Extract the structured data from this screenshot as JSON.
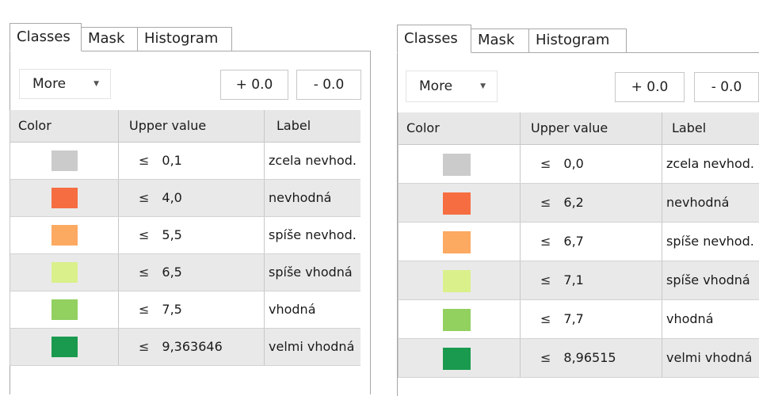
{
  "panels": [
    {
      "tabs": [
        "Classes",
        "Mask",
        "Histogram"
      ],
      "more_label": "More",
      "plus_label": "+ 0.0",
      "minus_label": "- 0.0",
      "columns": [
        "Color",
        "Upper value",
        "Label"
      ],
      "le_symbol": "≤",
      "rows": [
        {
          "color": "#cbcbcb",
          "value": "0,1",
          "label": "zcela nevhod."
        },
        {
          "color": "#f56d41",
          "value": "4,0",
          "label": "nevhodná"
        },
        {
          "color": "#fca962",
          "value": "5,5",
          "label": "spíše nevhod."
        },
        {
          "color": "#daf08b",
          "value": "6,5",
          "label": "spíše vhodná"
        },
        {
          "color": "#92d060",
          "value": "7,5",
          "label": "vhodná"
        },
        {
          "color": "#1a9a4e",
          "value": "9,363646",
          "label": "velmi vhodná"
        }
      ]
    },
    {
      "tabs": [
        "Classes",
        "Mask",
        "Histogram"
      ],
      "more_label": "More",
      "plus_label": "+ 0.0",
      "minus_label": "- 0.0",
      "columns": [
        "Color",
        "Upper value",
        "Label"
      ],
      "le_symbol": "≤",
      "rows": [
        {
          "color": "#cbcbcb",
          "value": "0,0",
          "label": "zcela nevhod."
        },
        {
          "color": "#f56d41",
          "value": "6,2",
          "label": "nevhodná"
        },
        {
          "color": "#fca962",
          "value": "6,7",
          "label": "spíše nevhod."
        },
        {
          "color": "#daf08b",
          "value": "7,1",
          "label": "spíše vhodná"
        },
        {
          "color": "#92d060",
          "value": "7,7",
          "label": "vhodná"
        },
        {
          "color": "#1a9a4e",
          "value": "8,96515",
          "label": "velmi vhodná"
        }
      ]
    }
  ]
}
